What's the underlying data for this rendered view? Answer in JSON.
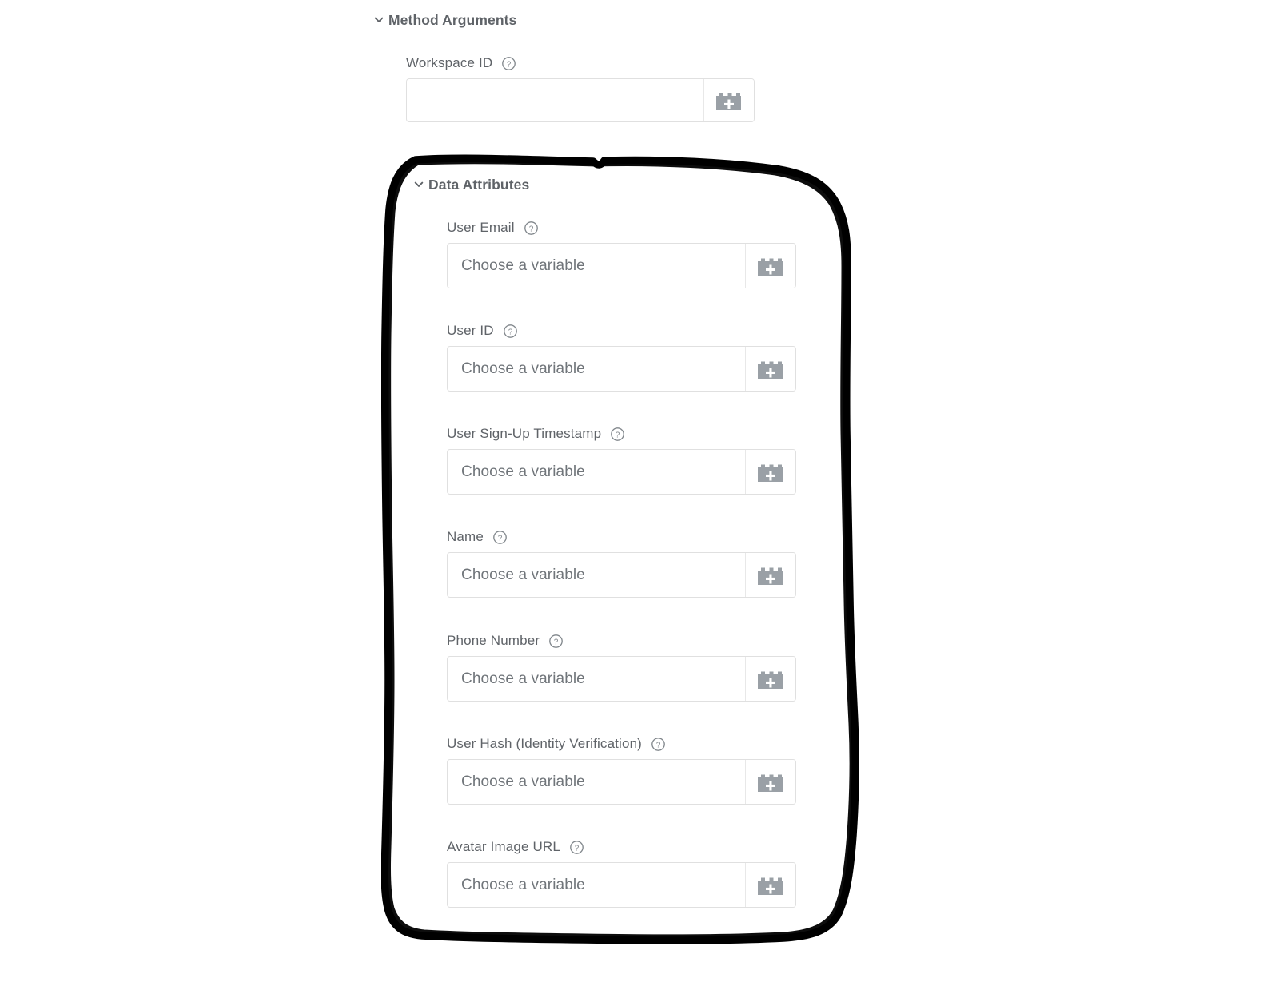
{
  "sections": [
    {
      "title": "Method Arguments",
      "toggle_icon": "chevron-down-icon",
      "fields": [
        {
          "label": "Workspace ID",
          "help_icon": "help-circle-icon",
          "value": "",
          "placeholder": "",
          "picker_icon": "variable-picker-lego-icon"
        }
      ]
    },
    {
      "title": "Data Attributes",
      "toggle_icon": "chevron-down-icon",
      "fields": [
        {
          "label": "User Email",
          "help_icon": "help-circle-icon",
          "value": "",
          "placeholder": "Choose a variable",
          "picker_icon": "variable-picker-lego-icon"
        },
        {
          "label": "User ID",
          "help_icon": "help-circle-icon",
          "value": "",
          "placeholder": "Choose a variable",
          "picker_icon": "variable-picker-lego-icon"
        },
        {
          "label": "User Sign-Up Timestamp",
          "help_icon": "help-circle-icon",
          "value": "",
          "placeholder": "Choose a variable",
          "picker_icon": "variable-picker-lego-icon"
        },
        {
          "label": "Name",
          "help_icon": "help-circle-icon",
          "value": "",
          "placeholder": "Choose a variable",
          "picker_icon": "variable-picker-lego-icon"
        },
        {
          "label": "Phone Number",
          "help_icon": "help-circle-icon",
          "value": "",
          "placeholder": "Choose a variable",
          "picker_icon": "variable-picker-lego-icon"
        },
        {
          "label": "User Hash (Identity Verification)",
          "help_icon": "help-circle-icon",
          "value": "",
          "placeholder": "Choose a variable",
          "picker_icon": "variable-picker-lego-icon"
        },
        {
          "label": "Avatar Image URL",
          "help_icon": "help-circle-icon",
          "value": "",
          "placeholder": "Choose a variable",
          "picker_icon": "variable-picker-lego-icon"
        }
      ]
    }
  ],
  "annotation": {
    "shape": "hand-drawn-rounded-rectangle",
    "color": "#000000",
    "stroke_width": 9,
    "encloses": "Data Attributes"
  },
  "colors": {
    "page_background": "#ffffff",
    "section_title": "#5f6368",
    "field_label": "#5f6368",
    "placeholder": "#70757a",
    "input_border": "#e0e0e0",
    "picker_icon": "#9aa0a6",
    "annotation": "#000000"
  },
  "labels_text": {
    "method_arguments": "Method Arguments",
    "data_attributes": "Data Attributes",
    "workspace_id": "Workspace ID",
    "user_email": "User Email",
    "user_id": "User ID",
    "user_signup_timestamp": "User Sign-Up Timestamp",
    "name": "Name",
    "phone_number": "Phone Number",
    "user_hash": "User Hash (Identity Verification)",
    "avatar_image_url": "Avatar Image URL",
    "choose_variable": "Choose a variable"
  }
}
